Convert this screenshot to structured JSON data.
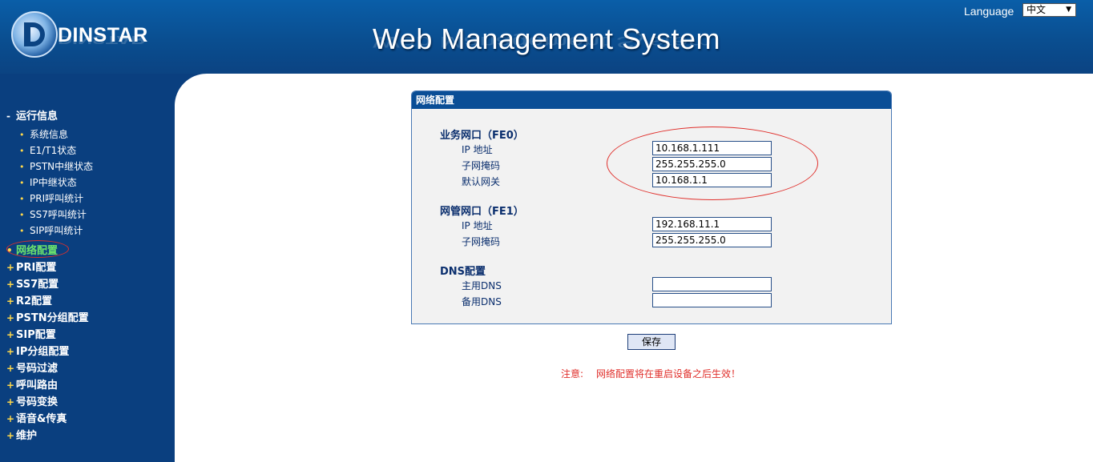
{
  "header": {
    "logo_text": "DINSTAR",
    "title": "Web Management System",
    "language_label": "Language",
    "language_value": "中文"
  },
  "sidebar": {
    "sections": [
      {
        "label": "运行信息",
        "symbol": "-",
        "expanded": true,
        "items": [
          "系统信息",
          "E1/T1状态",
          "PSTN中继状态",
          "IP中继状态",
          "PRI呼叫统计",
          "SS7呼叫统计",
          "SIP呼叫统计"
        ]
      },
      {
        "label": "网络配置",
        "symbol": "•",
        "active": true
      },
      {
        "label": "PRI配置",
        "symbol": "+"
      },
      {
        "label": "SS7配置",
        "symbol": "+"
      },
      {
        "label": "R2配置",
        "symbol": "+"
      },
      {
        "label": "PSTN分组配置",
        "symbol": "+"
      },
      {
        "label": "SIP配置",
        "symbol": "+"
      },
      {
        "label": "IP分组配置",
        "symbol": "+"
      },
      {
        "label": "号码过滤",
        "symbol": "+"
      },
      {
        "label": "呼叫路由",
        "symbol": "+"
      },
      {
        "label": "号码变换",
        "symbol": "+"
      },
      {
        "label": "语音&传真",
        "symbol": "+"
      },
      {
        "label": "维护",
        "symbol": "+"
      }
    ]
  },
  "panel": {
    "title": "网络配置",
    "fe0": {
      "title": "业务网口（FE0）",
      "ip_label": "IP 地址",
      "ip_value": "10.168.1.111",
      "mask_label": "子网掩码",
      "mask_value": "255.255.255.0",
      "gateway_label": "默认网关",
      "gateway_value": "10.168.1.1"
    },
    "fe1": {
      "title": "网管网口（FE1）",
      "ip_label": "IP 地址",
      "ip_value": "192.168.11.1",
      "mask_label": "子网掩码",
      "mask_value": "255.255.255.0"
    },
    "dns": {
      "title": "DNS配置",
      "primary_label": "主用DNS",
      "primary_value": "",
      "secondary_label": "备用DNS",
      "secondary_value": ""
    }
  },
  "save_label": "保存",
  "note": {
    "prefix": "注意:",
    "text": "网络配置将在重启设备之后生效！"
  },
  "colors": {
    "header_blue": "#0a4e90",
    "sidebar_blue": "#0a3f7f",
    "active_green": "#6ce36c",
    "annotation_red": "#e0302c"
  }
}
